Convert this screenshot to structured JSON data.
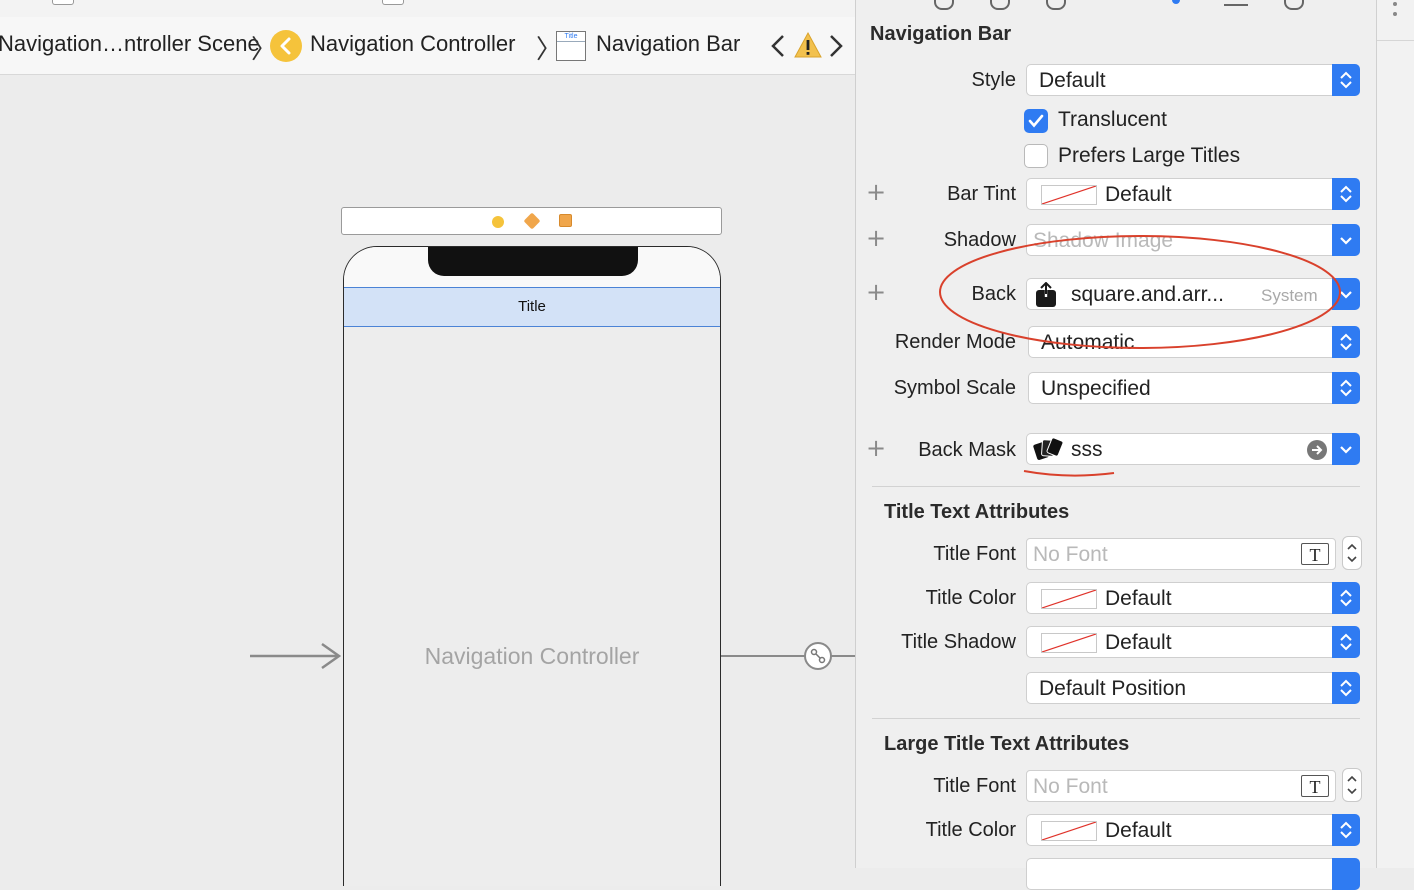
{
  "breadcrumb": {
    "scene": "Navigation…ntroller Scene",
    "controller": "Navigation Controller",
    "bar": "Navigation Bar"
  },
  "canvas": {
    "nav_title": "Title",
    "controller_label": "Navigation Controller",
    "mini_thumb_label": "Title"
  },
  "inspector": {
    "section_nav": "Navigation Bar",
    "style": {
      "label": "Style",
      "value": "Default"
    },
    "translucent": {
      "label": "Translucent",
      "checked": true
    },
    "large_titles": {
      "label": "Prefers Large Titles",
      "checked": false
    },
    "bar_tint": {
      "label": "Bar Tint",
      "value": "Default"
    },
    "shadow": {
      "label": "Shadow",
      "placeholder": "Shadow Image"
    },
    "back": {
      "label": "Back",
      "value": "square.and.arr...",
      "tag": "System"
    },
    "render_mode": {
      "label": "Render Mode",
      "value": "Automatic"
    },
    "symbol_scale": {
      "label": "Symbol Scale",
      "value": "Unspecified"
    },
    "back_mask": {
      "label": "Back Mask",
      "value": "sss"
    },
    "section_title_text": "Title Text Attributes",
    "title_font": {
      "label": "Title Font",
      "placeholder": "No Font"
    },
    "title_color": {
      "label": "Title Color",
      "value": "Default"
    },
    "title_shadow": {
      "label": "Title Shadow",
      "value": "Default"
    },
    "shadow_position": {
      "value": "Default Position"
    },
    "section_large_title": "Large Title Text Attributes",
    "large_title_font": {
      "label": "Title Font",
      "placeholder": "No Font"
    },
    "large_title_color": {
      "label": "Title Color",
      "value": "Default"
    }
  },
  "colors": {
    "accent": "#2f7bf2",
    "annotation": "#d9412c",
    "nav_bar_fill": "#d3e2f7",
    "warning": "#f2c14e"
  }
}
